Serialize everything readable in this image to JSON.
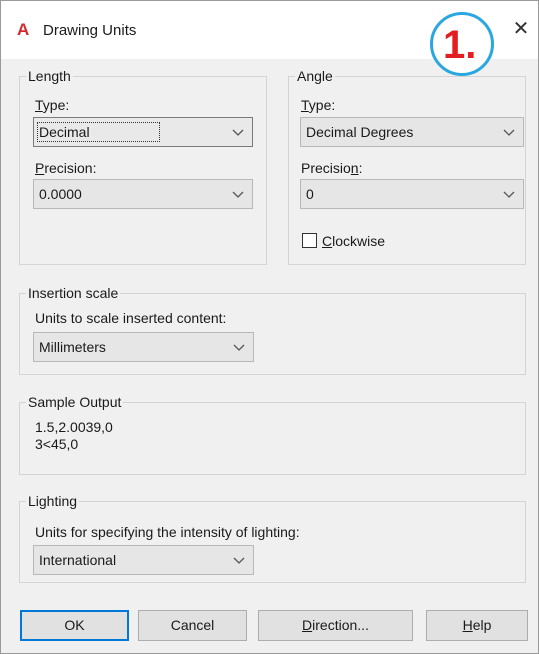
{
  "window": {
    "title": "Drawing Units",
    "app_icon": "A",
    "close_glyph": "✕"
  },
  "badge": {
    "text": "1."
  },
  "length": {
    "group_label": "Length",
    "type_label_first": "T",
    "type_label_rest": "ype:",
    "type_value": "Decimal",
    "precision_label_first": "P",
    "precision_label_rest": "recision:",
    "precision_value": "0.0000"
  },
  "angle": {
    "group_label": "Angle",
    "type_label_first": "T",
    "type_label_rest": "ype:",
    "type_value": "Decimal Degrees",
    "precision_label_start": "Precisio",
    "precision_label_mnemonic": "n",
    "precision_label_end": ":",
    "precision_value": "0",
    "clockwise_mnemonic": "C",
    "clockwise_rest": "lockwise",
    "clockwise_checked": false
  },
  "insertion_scale": {
    "group_label": "Insertion scale",
    "units_label": "Units to scale inserted content:",
    "units_value": "Millimeters"
  },
  "sample_output": {
    "group_label": "Sample Output",
    "line1": "1.5,2.0039,0",
    "line2": "3<45,0"
  },
  "lighting": {
    "group_label": "Lighting",
    "units_label": "Units for specifying the intensity of lighting:",
    "units_value": "International"
  },
  "buttons": {
    "ok": "OK",
    "cancel": "Cancel",
    "direction_mnemonic": "D",
    "direction_rest": "irection...",
    "help_mnemonic": "H",
    "help_rest": "elp"
  },
  "colors": {
    "accent": "#0078d7",
    "badge_ring": "#2aa7e0",
    "badge_text": "#e41e20",
    "app_icon": "#d6282f"
  }
}
